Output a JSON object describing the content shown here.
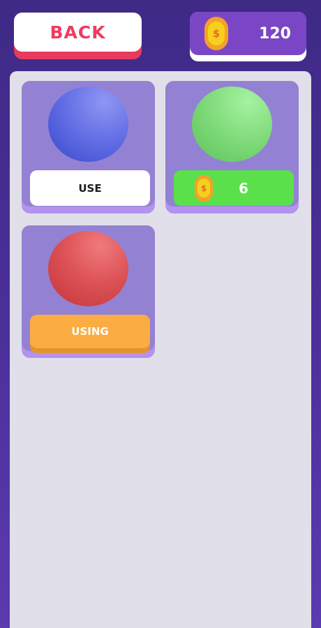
{
  "header": {
    "back_label": "BACK",
    "coin_symbol": "$",
    "coin_balance": "120"
  },
  "skins": [
    {
      "name": "blue-ball",
      "color": "#5966e0",
      "button": "USE"
    },
    {
      "name": "green-ball",
      "color": "#7fdc7a",
      "price": "6",
      "coin_symbol": "$"
    },
    {
      "name": "red-ball",
      "color": "#dc4d52",
      "button": "USING"
    }
  ],
  "colors": {
    "background": "#4b2f98",
    "accent_red": "#ef3b62",
    "coin_orange": "#f4a12a",
    "coin_yellow": "#f5d11d",
    "buy_green": "#5ae04a",
    "using_orange": "#fbac42"
  }
}
